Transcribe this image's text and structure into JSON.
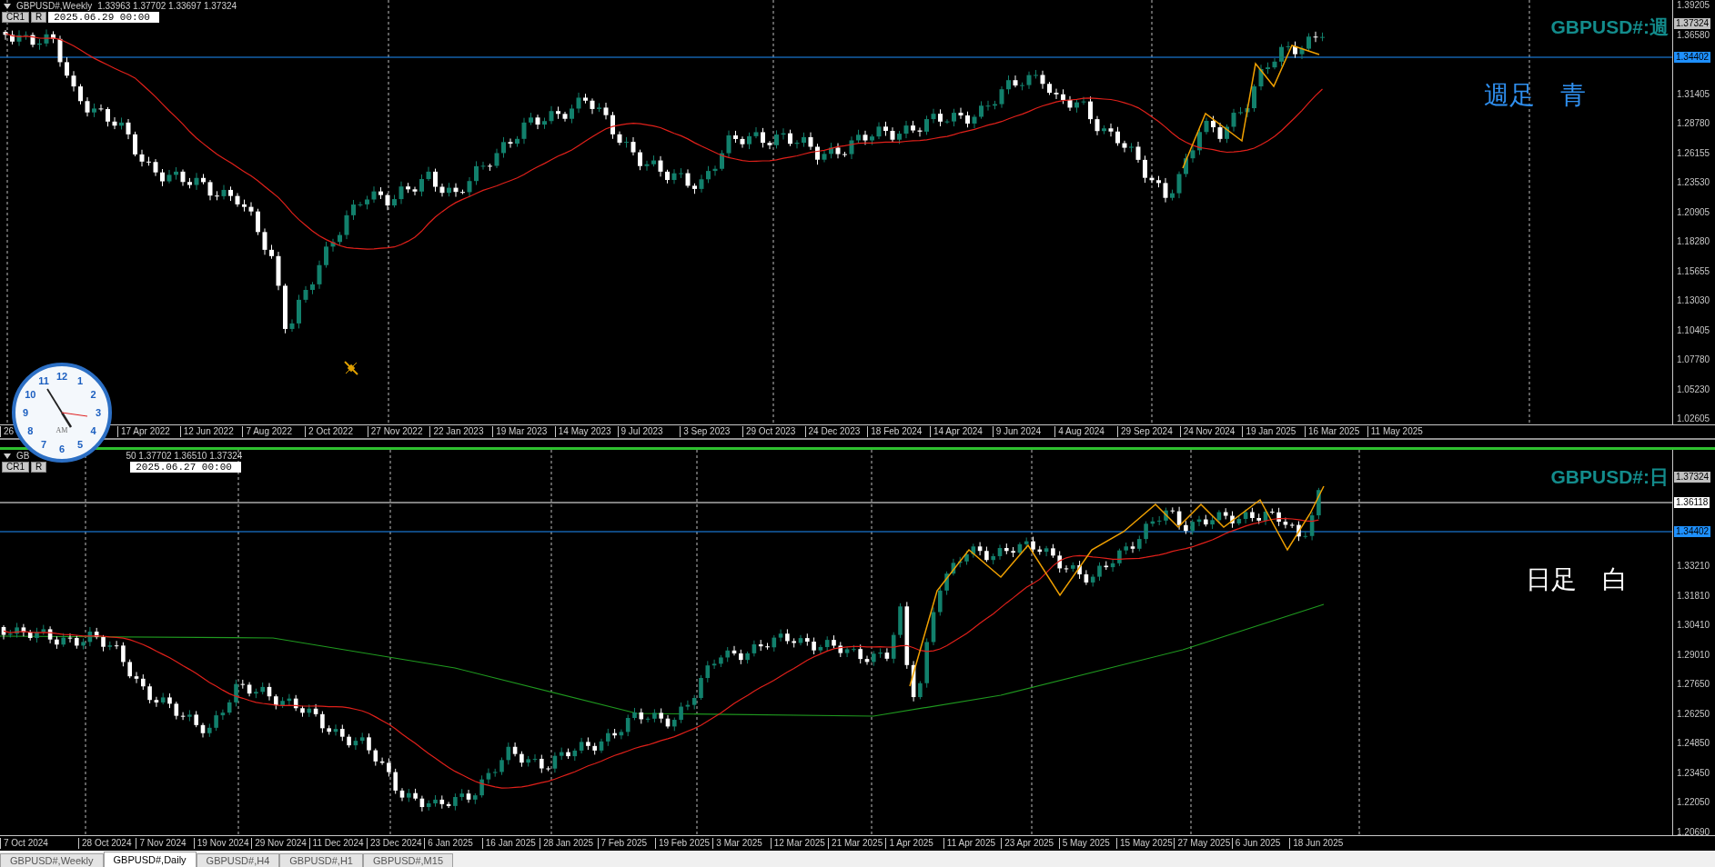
{
  "weekly_chart": {
    "symbol": "GBPUSD#,Weekly",
    "ohlc": "1.33963 1.37702 1.33697 1.37324",
    "buttons": [
      "CR1",
      "R"
    ],
    "date": "2025.06.29 00:00",
    "title": "GBPUSD#:週",
    "note": "週足　青",
    "price_markers": [
      {
        "label": "1.37324",
        "color": "#c0c0c0"
      },
      {
        "label": "1.34402",
        "color": "#1e90ff"
      }
    ],
    "price_labels": [
      "1.39205",
      "1.36580",
      "1.31405",
      "1.28780",
      "1.26155",
      "1.23530",
      "1.20905",
      "1.18280",
      "1.15655",
      "1.13030",
      "1.10405",
      "1.07780",
      "1.05230",
      "1.02605"
    ],
    "time_labels": [
      "26",
      "17 Apr 2022",
      "12 Jun 2022",
      "7 Aug 2022",
      "2 Oct 2022",
      "27 Nov 2022",
      "22 Jan 2023",
      "19 Mar 2023",
      "14 May 2023",
      "9 Jul 2023",
      "3 Sep 2023",
      "29 Oct 2023",
      "24 Dec 2023",
      "18 Feb 2024",
      "14 Apr 2024",
      "9 Jun 2024",
      "4 Aug 2024",
      "29 Sep 2024",
      "24 Nov 2024",
      "19 Jan 2025",
      "16 Mar 2025",
      "11 May 2025"
    ]
  },
  "daily_chart": {
    "symbol": "GB",
    "ohlc": "50 1.37702 1.36510 1.37324",
    "buttons": [
      "CR1",
      "R"
    ],
    "date": "2025.06.27 00:00",
    "title": "GBPUSD#:日",
    "note": "日足　白",
    "price_markers": [
      {
        "label": "1.37324",
        "color": "#c0c0c0"
      },
      {
        "label": "1.36118",
        "color": "#ffffff"
      },
      {
        "label": "1.34402",
        "color": "#1e90ff"
      }
    ],
    "price_labels": [
      "1.33210",
      "1.31810",
      "1.30410",
      "1.29010",
      "1.27650",
      "1.26250",
      "1.24850",
      "1.23450",
      "1.22050",
      "1.20690"
    ],
    "time_labels": [
      "7 Oct 2024",
      "28 Oct 2024",
      "7 Nov 2024",
      "19 Nov 2024",
      "29 Nov 2024",
      "11 Dec 2024",
      "23 Dec 2024",
      "6 Jan 2025",
      "16 Jan 2025",
      "28 Jan 2025",
      "7 Feb 2025",
      "19 Feb 2025",
      "3 Mar 2025",
      "12 Mar 2025",
      "21 Mar 2025",
      "1 Apr 2025",
      "11 Apr 2025",
      "23 Apr 2025",
      "5 May 2025",
      "15 May 2025",
      "27 May 2025",
      "6 Jun 2025",
      "18 Jun 2025"
    ]
  },
  "clock": {
    "numerals": [
      "12",
      "1",
      "2",
      "3",
      "4",
      "5",
      "6",
      "7",
      "8",
      "9",
      "10",
      "11"
    ],
    "period": "AM"
  },
  "tabs": [
    {
      "label": "GBPUSD#,Weekly",
      "selected": false
    },
    {
      "label": "GBPUSD#,Daily",
      "selected": true
    },
    {
      "label": "GBPUSD#,H4",
      "selected": false
    },
    {
      "label": "GBPUSD#,H1",
      "selected": false
    },
    {
      "label": "GBPUSD#,M15",
      "selected": false
    }
  ]
}
